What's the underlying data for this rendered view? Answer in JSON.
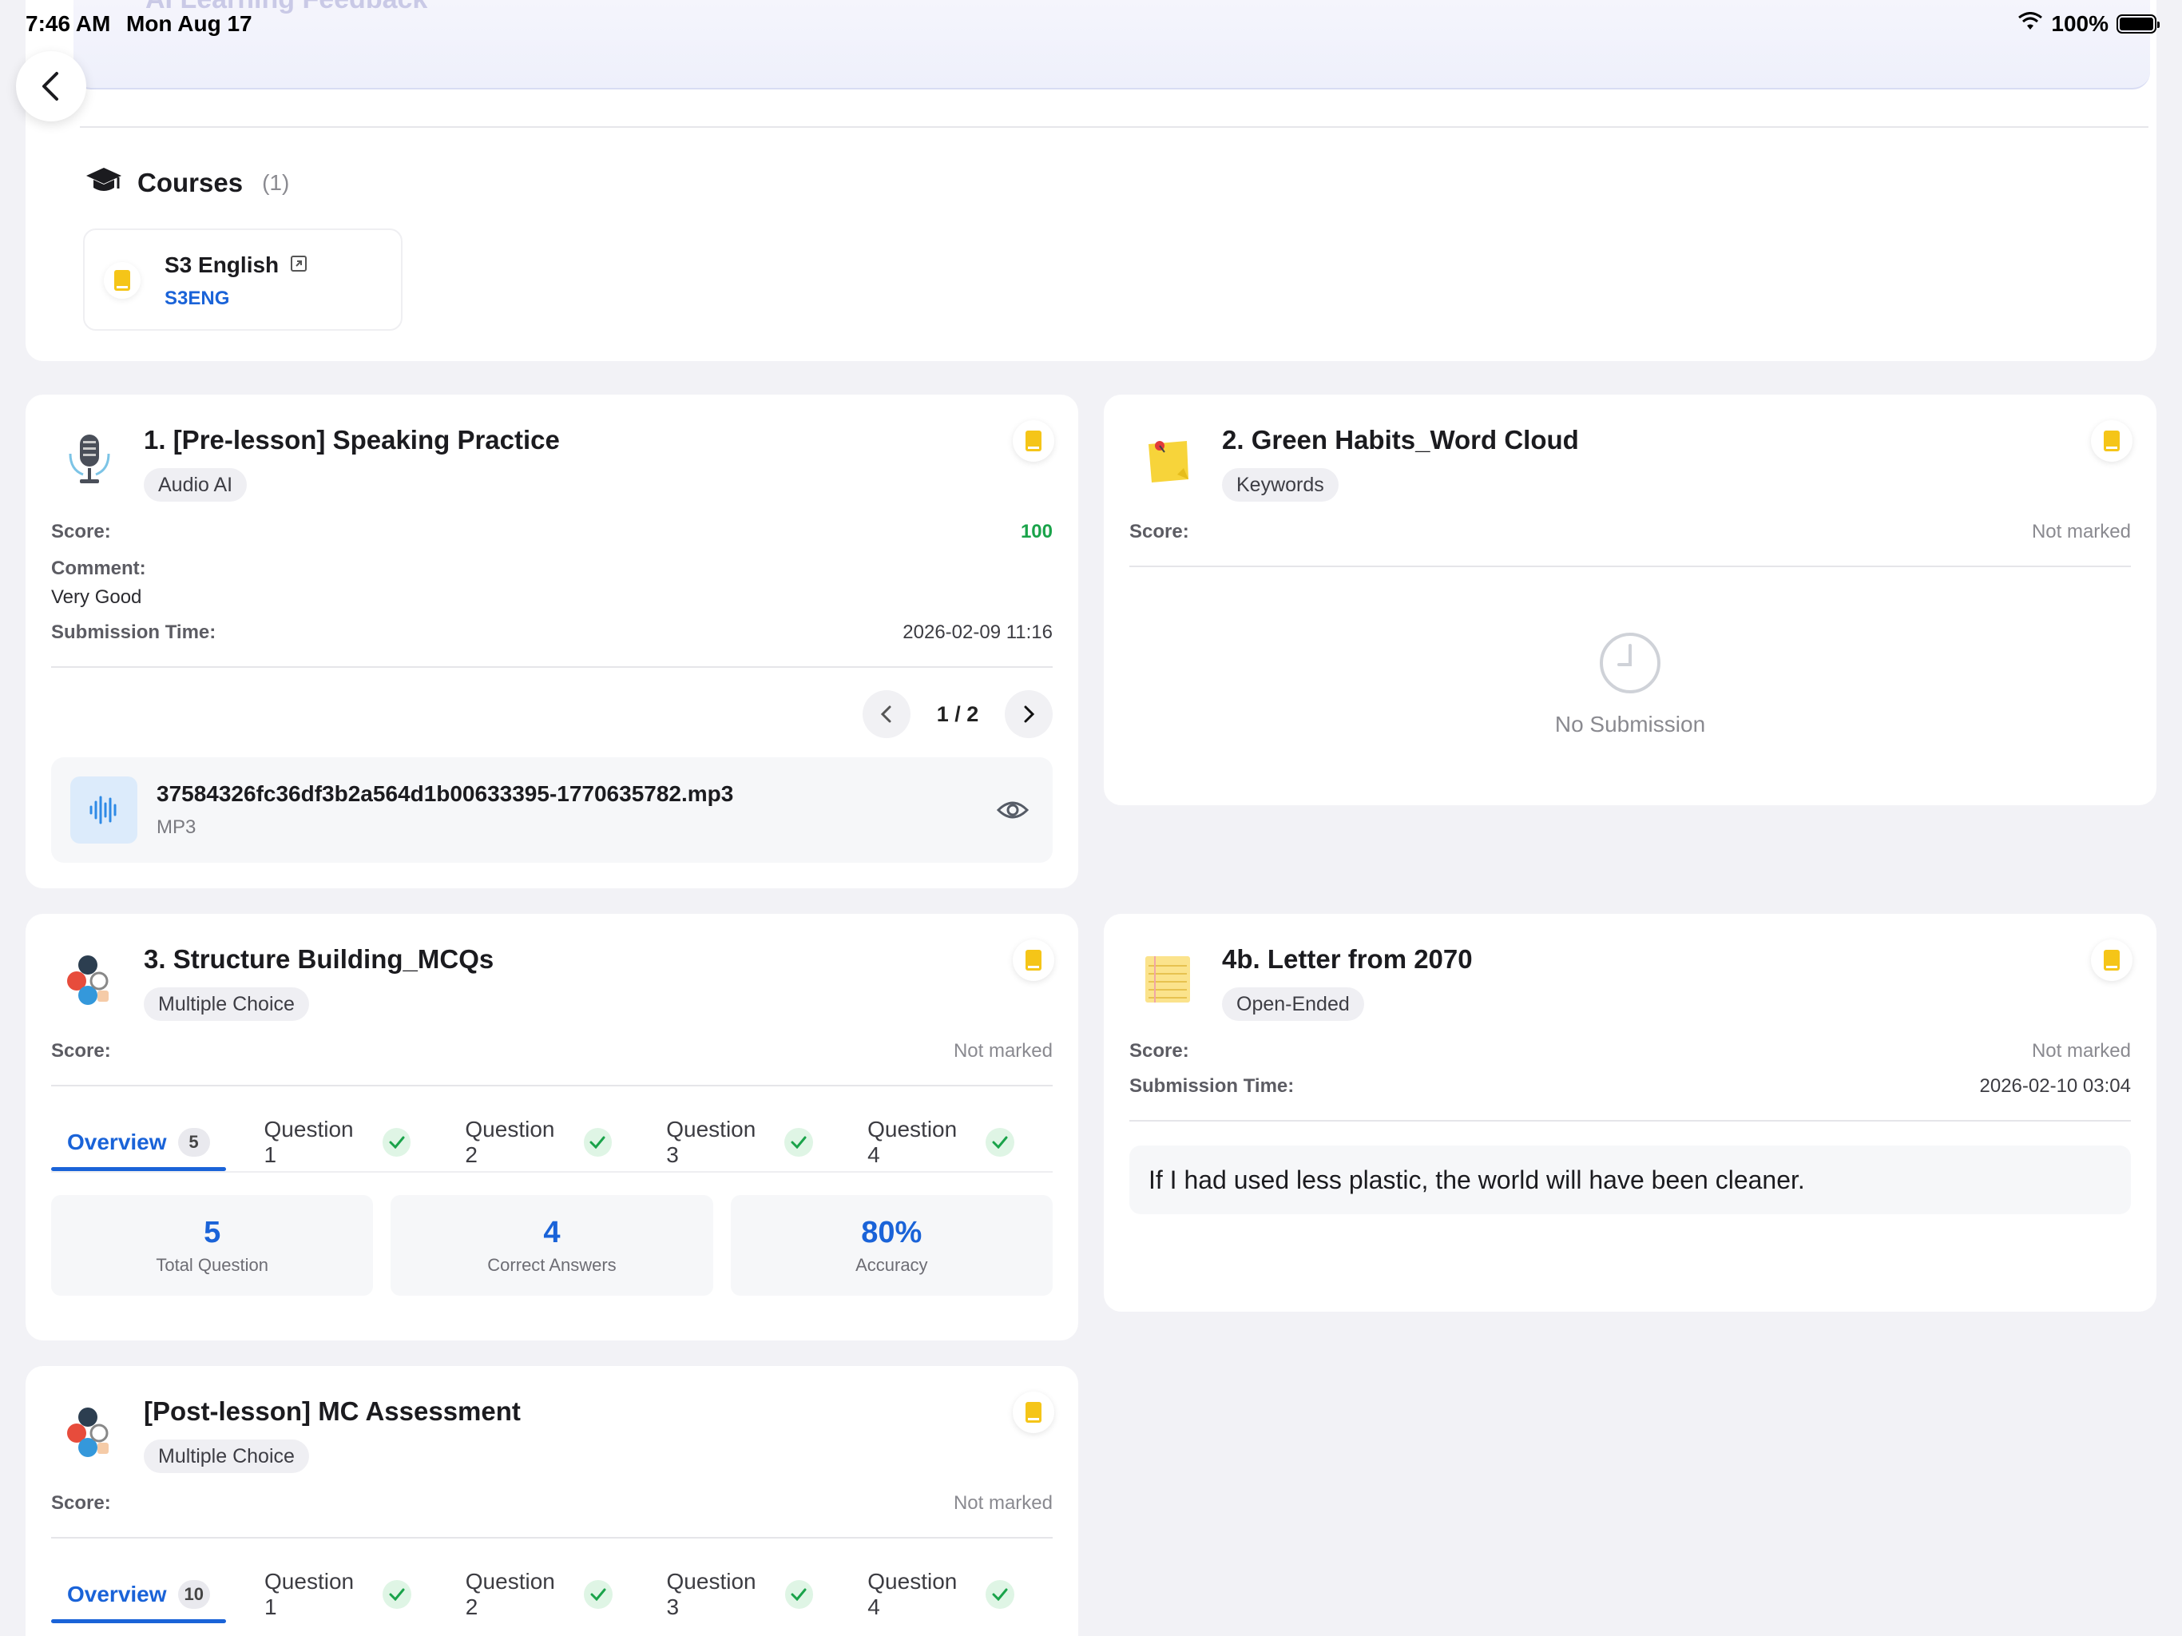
{
  "status_bar": {
    "time": "7:46 AM",
    "date": "Mon Aug 17",
    "battery": "100%"
  },
  "header": {
    "title_partial": "AI Learning Feedback"
  },
  "courses": {
    "title": "Courses",
    "count": "(1)",
    "items": [
      {
        "name": "S3 English",
        "code": "S3ENG"
      }
    ]
  },
  "labels": {
    "score": "Score:",
    "comment": "Comment:",
    "submission_time": "Submission Time:",
    "not_marked": "Not marked",
    "no_submission": "No Submission",
    "overview": "Overview",
    "total_question": "Total Question",
    "correct_answers": "Correct Answers",
    "accuracy": "Accuracy"
  },
  "cards": [
    {
      "title": "1. [Pre-lesson] Speaking Practice",
      "tag": "Audio AI",
      "score": "100",
      "comment": "Very Good",
      "submission_time": "2026-02-09 11:16",
      "pager": "1 / 2",
      "file": {
        "name": "37584326fc36df3b2a564d1b00633395-1770635782.mp3",
        "type": "MP3"
      }
    },
    {
      "title": "2. Green Habits_Word Cloud",
      "tag": "Keywords",
      "score": "Not marked"
    },
    {
      "title": "3. Structure Building_MCQs",
      "tag": "Multiple Choice",
      "score": "Not marked",
      "overview_count": "5",
      "tabs": [
        "Question 1",
        "Question 2",
        "Question 3",
        "Question 4"
      ],
      "stats": {
        "total": "5",
        "correct": "4",
        "accuracy": "80%"
      }
    },
    {
      "title": "4b. Letter from 2070",
      "tag": "Open-Ended",
      "score": "Not marked",
      "submission_time": "2026-02-10 03:04",
      "answer": "If I had used less plastic, the world will have been cleaner."
    },
    {
      "title": "[Post-lesson] MC Assessment",
      "tag": "Multiple Choice",
      "score": "Not marked",
      "overview_count": "10",
      "tabs": [
        "Question 1",
        "Question 2",
        "Question 3",
        "Question 4"
      ]
    }
  ],
  "colors": {
    "accent_blue": "#1a63d8",
    "score_green": "#1aa34a",
    "book_yellow": "#f5c518",
    "background": "#f2f2f6"
  }
}
